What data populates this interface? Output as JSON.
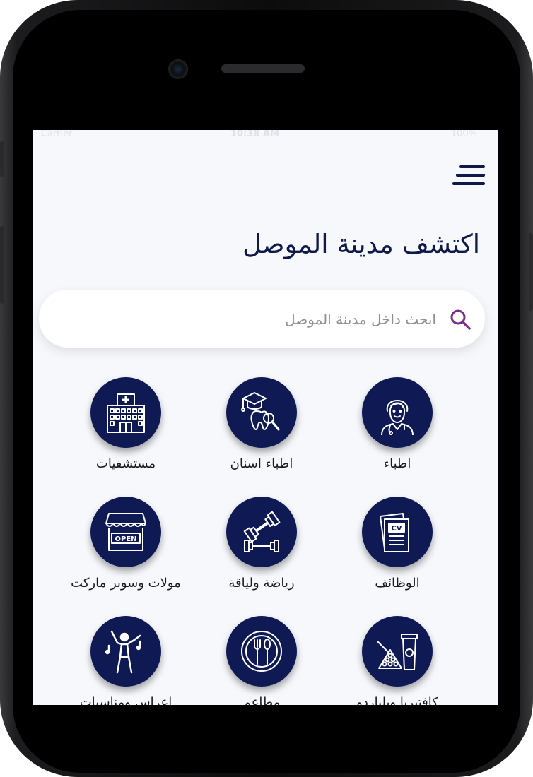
{
  "status_bar": {
    "carrier": "Carrier",
    "time": "10:38 AM",
    "battery": "100%"
  },
  "header": {
    "menu_icon": "hamburger-menu-icon",
    "title": "اكتشف مدينة الموصل"
  },
  "search": {
    "placeholder": "ابحث داخل مدينة الموصل",
    "icon": "search-icon",
    "accent_color": "#7b2d8e"
  },
  "categories": [
    {
      "label": "اطباء",
      "icon": "doctor-icon"
    },
    {
      "label": "اطباء اسنان",
      "icon": "dentist-icon"
    },
    {
      "label": "مستشفيات",
      "icon": "hospital-icon"
    },
    {
      "label": "الوظائف",
      "icon": "cv-jobs-icon"
    },
    {
      "label": "رياضة ولياقة",
      "icon": "dumbbell-icon"
    },
    {
      "label": "مولات وسوبر ماركت",
      "icon": "open-shop-icon"
    },
    {
      "label": "كافتيريا وبلياردو",
      "icon": "billiard-coffee-icon"
    },
    {
      "label": "مطاعم",
      "icon": "restaurant-plate-icon"
    },
    {
      "label": "اعراس ومناسبات",
      "icon": "dancing-person-icon"
    }
  ],
  "colors": {
    "primary": "#0f1a54",
    "background": "#f7f8fc",
    "title": "#101a4a"
  }
}
